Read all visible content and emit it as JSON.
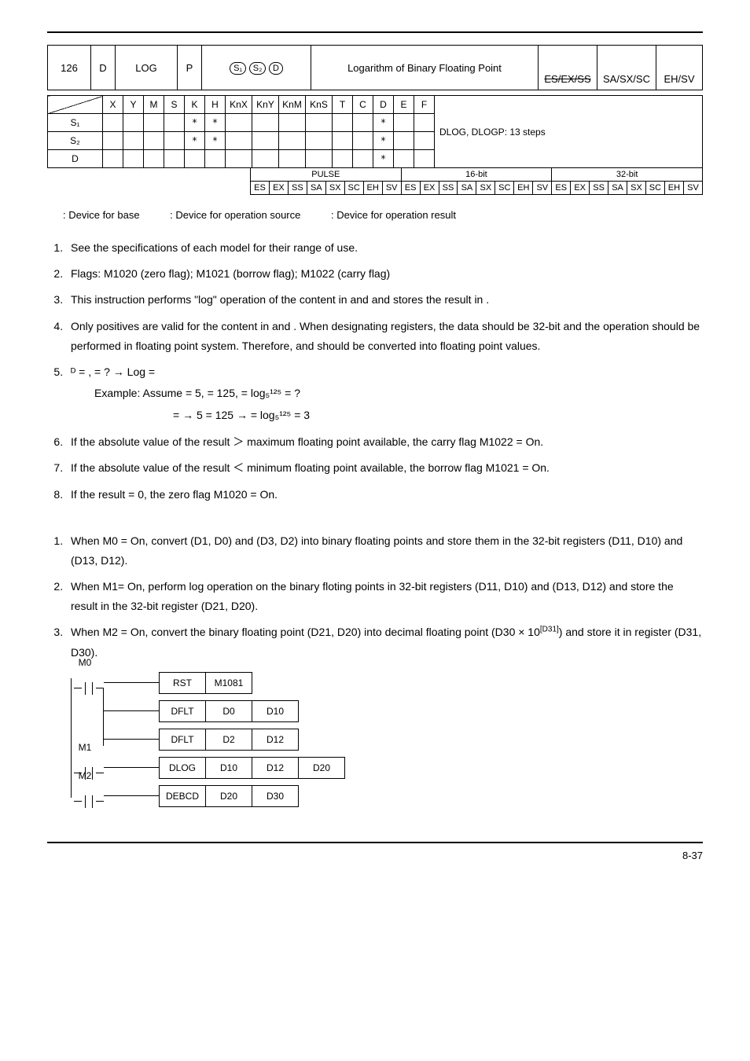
{
  "header": {
    "api_num": "126",
    "d_flag": "D",
    "mnemonic": "LOG",
    "p_flag": "P",
    "op1": "S₁",
    "op2": "S₂",
    "op3": "D",
    "function": "Logarithm of Binary Floating Point",
    "controllers": [
      "ES/EX/SS",
      "SA/SX/SC",
      "EH/SV"
    ]
  },
  "matrix": {
    "cols": [
      "X",
      "Y",
      "M",
      "S",
      "K",
      "H",
      "KnX",
      "KnY",
      "KnM",
      "KnS",
      "T",
      "C",
      "D",
      "E",
      "F"
    ],
    "rows": [
      {
        "label": "S₁",
        "cells": [
          "",
          "",
          "",
          "",
          "*",
          "*",
          "",
          "",
          "",
          "",
          "",
          "",
          "*",
          "",
          ""
        ]
      },
      {
        "label": "S₂",
        "cells": [
          "",
          "",
          "",
          "",
          "*",
          "*",
          "",
          "",
          "",
          "",
          "",
          "",
          "*",
          "",
          ""
        ]
      },
      {
        "label": "D",
        "cells": [
          "",
          "",
          "",
          "",
          "",
          "",
          "",
          "",
          "",
          "",
          "",
          "",
          "*",
          "",
          ""
        ]
      }
    ],
    "steps": "DLOG, DLOGP: 13 steps"
  },
  "pulse": {
    "groups": [
      "PULSE",
      "16-bit",
      "32-bit"
    ],
    "es_row": [
      "ES",
      "EX",
      "SS",
      "SA",
      "SX",
      "SC",
      "EH",
      "SV",
      "ES",
      "EX",
      "SS",
      "SA",
      "SX",
      "SC",
      "EH",
      "SV",
      "ES",
      "EX",
      "SS",
      "SA",
      "SX",
      "SC",
      "EH",
      "SV"
    ]
  },
  "devices": {
    "base": ": Device for base",
    "source": ": Device for operation source",
    "result": ": Device for operation result"
  },
  "explain": [
    "See the specifications of each model for their range of use.",
    "Flags: M1020 (zero flag); M1021 (borrow flag); M1022 (carry flag)",
    "This instruction performs \"log\" operation of the content in     and     and stores the result in   .",
    "Only positives are valid for the content in     and    . When designating    registers, the data should be 32-bit and the operation should be performed in floating point system. Therefore,     and     should be converted into floating point values."
  ],
  "item5": {
    "line1_pre": "",
    "line1": "ᴰ =    ,    = ? → Log     =",
    "example": "Example: Assume     = 5,     = 125,    = log₅¹²⁵ = ?",
    "result": "=     → 5   = 125 →    = log₅¹²⁵ = 3"
  },
  "rest": [
    "If the absolute value of the result  ＞  maximum floating point available, the carry flag M1022 = On.",
    "If the absolute value of the result  ＜  minimum floating point available, the borrow flag M1021 = On.",
    "If the result = 0, the zero flag M1020 = On."
  ],
  "program": [
    "When M0 = On, convert (D1, D0) and (D3, D2) into binary floating points and store them in the 32-bit registers (D11, D10) and (D13, D12).",
    "When M1= On, perform log operation on the binary floting points in 32-bit registers (D11, D10) and (D13, D12) and store the result in the 32-bit register (D21, D20).",
    "When M2 = On, convert the binary floating point (D21, D20) into decimal floating point (D30 × 10[D31]) and store it in register (D31, D30)."
  ],
  "ladder": {
    "contacts": [
      "M0",
      "M1",
      "M2"
    ],
    "rungs": [
      {
        "op": "RST",
        "args": [
          "M1081"
        ]
      },
      {
        "op": "DFLT",
        "args": [
          "D0",
          "D10"
        ]
      },
      {
        "op": "DFLT",
        "args": [
          "D2",
          "D12"
        ]
      },
      {
        "op": "DLOG",
        "args": [
          "D10",
          "D12",
          "D20"
        ]
      },
      {
        "op": "DEBCD",
        "args": [
          "D20",
          "D30"
        ]
      }
    ]
  },
  "footer": "8-37",
  "sup_d31": "[D31]"
}
